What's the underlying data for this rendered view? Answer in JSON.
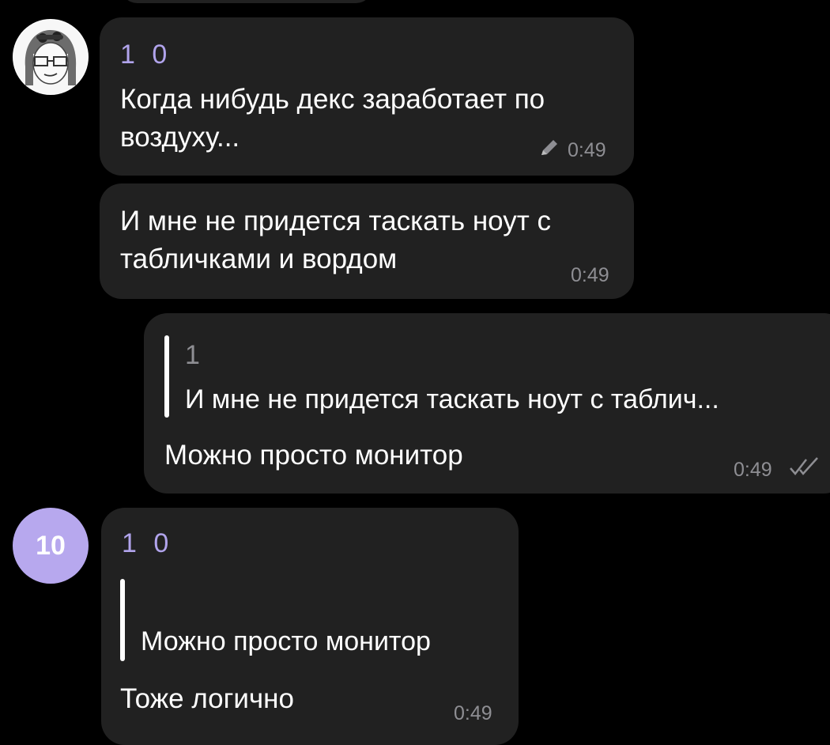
{
  "messages": [
    {
      "sender": "1 0",
      "text_line1": "Когда нибудь декс заработает по",
      "text_line2": "воздуху...",
      "time": "0:49",
      "edited_icon": "pencil-icon"
    },
    {
      "text_line1": "И мне не придется таскать ноут с",
      "text_line2": "табличками и вордом",
      "time": "0:49"
    },
    {
      "reply_name": "1",
      "reply_text": "И мне не придется таскать ноут с таблич...",
      "text": "Можно просто монитор",
      "time": "0:49",
      "status_icon": "double-check-icon"
    },
    {
      "avatar_text": "10",
      "sender": "1 0",
      "reply_text": "Можно просто монитор",
      "text": "Тоже логично",
      "time": "0:49"
    }
  ],
  "colors": {
    "background": "#000000",
    "bubble": "#212121",
    "sender": "#b1a4ec",
    "avatar": "#b7a8ee",
    "time": "#8e8e93"
  }
}
